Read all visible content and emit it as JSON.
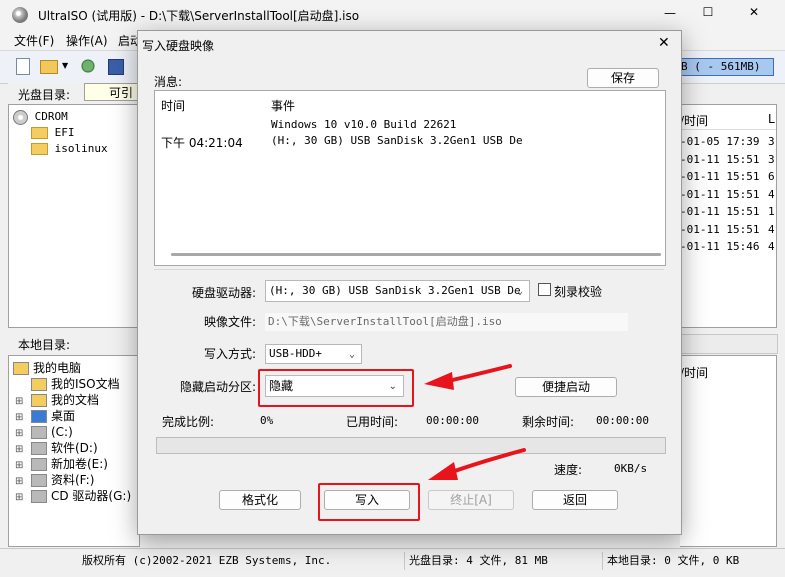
{
  "window": {
    "title": "UltraISO (试用版) - D:\\下载\\ServerInstallTool[启动盘].iso",
    "controls": [
      "—",
      "☐",
      "✕"
    ]
  },
  "menu": [
    "文件(F)",
    "操作(A)",
    "启动"
  ],
  "toolbar": {
    "size_indicator": "B ( - 561MB)"
  },
  "cd_path": {
    "label": "光盘目录:",
    "bootable_label": "可引导"
  },
  "cd_tree": [
    {
      "name": "CDROM"
    },
    {
      "name": "EFI"
    },
    {
      "name": "isolinux"
    }
  ],
  "cd_list": {
    "col_time": "/时间",
    "col_extra": "L",
    "rows": [
      {
        "time": "-01-05 17:39",
        "extra": "3"
      },
      {
        "time": "-01-11 15:51",
        "extra": "3"
      },
      {
        "time": "-01-11 15:51",
        "extra": "6"
      },
      {
        "time": "-01-11 15:51",
        "extra": "4"
      },
      {
        "time": "-01-11 15:51",
        "extra": "1"
      },
      {
        "time": "-01-11 15:51",
        "extra": "4"
      },
      {
        "time": "-01-11 15:46",
        "extra": "4"
      }
    ]
  },
  "local_path": {
    "label": "本地目录:"
  },
  "local_tree": [
    {
      "name": "我的电脑"
    },
    {
      "name": "我的ISO文档"
    },
    {
      "name": "我的文档"
    },
    {
      "name": "桌面"
    },
    {
      "name": "(C:)"
    },
    {
      "name": "软件(D:)"
    },
    {
      "name": "新加卷(E:)"
    },
    {
      "name": "资料(F:)"
    },
    {
      "name": "CD 驱动器(G:)"
    }
  ],
  "local_list": {
    "col_time": "/时间"
  },
  "status": {
    "copyright": "版权所有 (c)2002-2021 EZB Systems, Inc.",
    "cd_info": "光盘目录: 4 文件, 81 MB",
    "local_info": "本地目录: 0 文件, 0 KB"
  },
  "dialog": {
    "title": "写入硬盘映像",
    "close": "✕",
    "messages_label": "消息:",
    "save_button": "保存",
    "log_headers": {
      "time": "时间",
      "event": "事件"
    },
    "log_rows": [
      {
        "time": "",
        "event": "Windows 10 v10.0 Build 22621"
      },
      {
        "time": "下午 04:21:04",
        "event": "(H:, 30 GB) USB  SanDisk 3.2Gen1 USB De"
      }
    ],
    "disk_drive_label": "硬盘驱动器:",
    "disk_drive_value": "(H:, 30 GB) USB  SanDisk 3.2Gen1 USB De",
    "verify_label": "刻录校验",
    "verify_checked": false,
    "image_file_label": "映像文件:",
    "image_file_value": "D:\\下载\\ServerInstallTool[启动盘].iso",
    "write_method_label": "写入方式:",
    "write_method_value": "USB-HDD+",
    "hidden_partition_label": "隐藏启动分区:",
    "hidden_partition_value": "隐藏",
    "quick_boot_button": "便捷启动",
    "progress_label": "完成比例:",
    "progress_value": "0%",
    "progress_fraction": 0,
    "elapsed_label": "已用时间:",
    "elapsed_value": "00:00:00",
    "remaining_label": "剩余时间:",
    "remaining_value": "00:00:00",
    "speed_label": "速度:",
    "speed_value": "0KB/s",
    "format_button": "格式化",
    "write_button": "写入",
    "stop_button": "终止[A]",
    "back_button": "返回"
  },
  "colors": {
    "highlight": "#e8141c",
    "arrow": "#e8141c",
    "dialog_bg": "#f0f0f0",
    "toolbar_bg": "#eef2f8"
  }
}
